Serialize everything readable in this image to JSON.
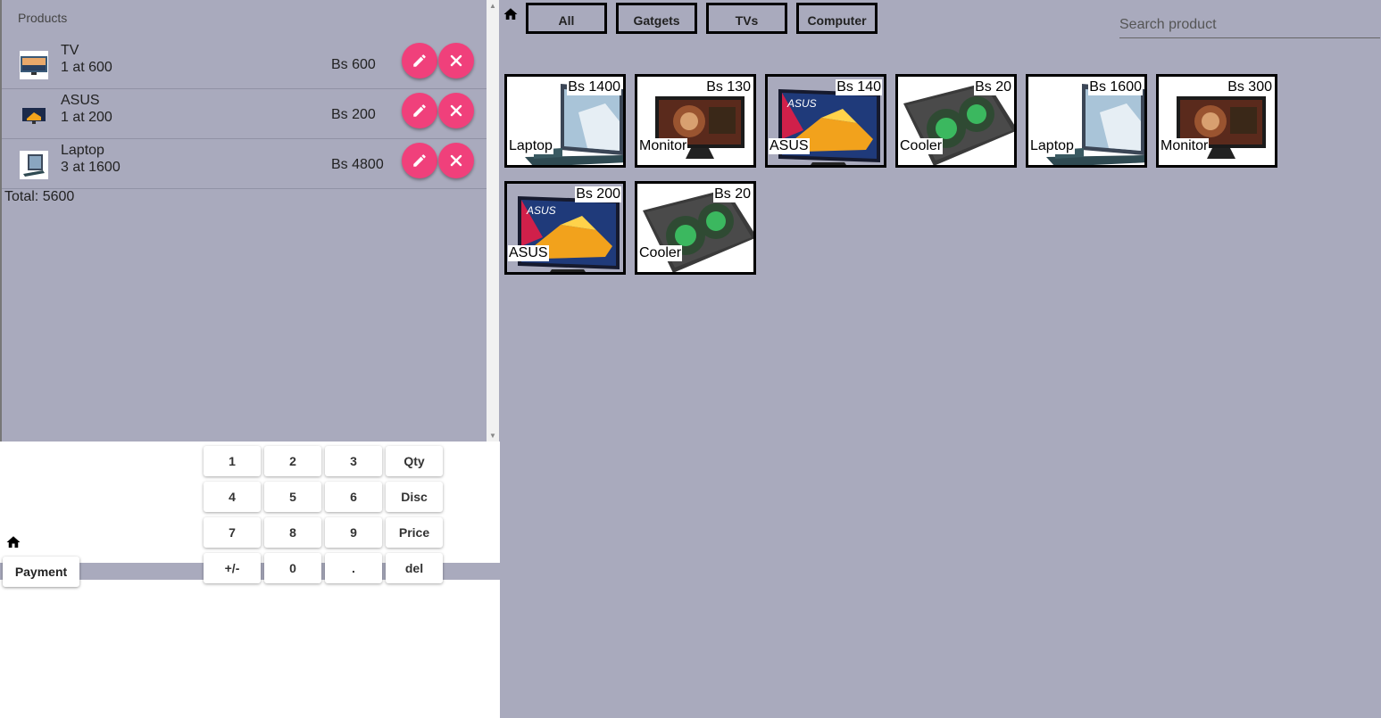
{
  "order": {
    "title": "Products",
    "items": [
      {
        "name": "TV",
        "qty_line": "1 at 600",
        "total": "Bs 600"
      },
      {
        "name": "ASUS",
        "qty_line": "1 at 200",
        "total": "Bs 200"
      },
      {
        "name": "Laptop",
        "qty_line": "3 at 1600",
        "total": "Bs 4800"
      }
    ],
    "total_label": "Total: 5600"
  },
  "pad": {
    "payment_label": "Payment",
    "keys": [
      "1",
      "2",
      "3",
      "Qty",
      "4",
      "5",
      "6",
      "Disc",
      "7",
      "8",
      "9",
      "Price",
      "+/-",
      "0",
      ".",
      "del"
    ]
  },
  "categories": [
    "All",
    "Gatgets",
    "TVs",
    "Computer"
  ],
  "search": {
    "placeholder": "Search product"
  },
  "products": [
    {
      "name": "Laptop",
      "price": "Bs 1400",
      "image": "laptop"
    },
    {
      "name": "Monitor",
      "price": "Bs 130",
      "image": "monitor"
    },
    {
      "name": "ASUS",
      "price": "Bs 140",
      "image": "asus"
    },
    {
      "name": "Cooler",
      "price": "Bs 20",
      "image": "cooler"
    },
    {
      "name": "Laptop",
      "price": "Bs 1600",
      "image": "laptop"
    },
    {
      "name": "Monitor",
      "price": "Bs 300",
      "image": "monitor"
    },
    {
      "name": "ASUS",
      "price": "Bs 200",
      "image": "asus"
    },
    {
      "name": "Cooler",
      "price": "Bs 20",
      "image": "cooler"
    }
  ],
  "colors": {
    "accent": "#f0407b",
    "background": "#a9aabd"
  }
}
